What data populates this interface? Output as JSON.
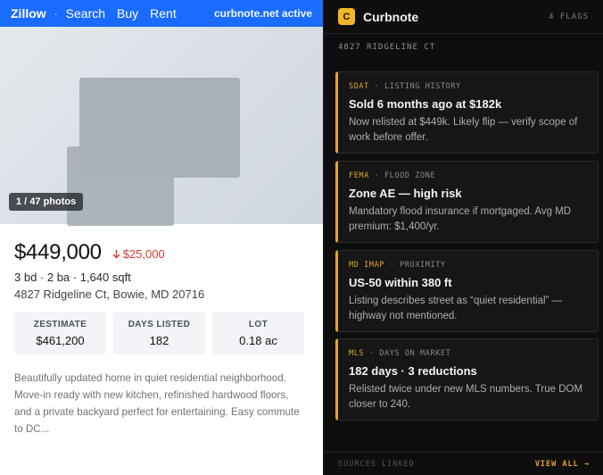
{
  "zillow": {
    "brand": "Zillow",
    "separator": "·",
    "nav": [
      "Search",
      "Buy",
      "Rent"
    ],
    "extension_status": "curbnote.net active",
    "photo_count": "1 / 47 photos",
    "price": "$449,000",
    "price_drop": "$25,000",
    "facts": "3 bd · 2 ba · 1,640 sqft",
    "address": "4827 Ridgeline Ct, Bowie, MD 20716",
    "stats": [
      {
        "label": "ZESTIMATE",
        "value": "$461,200"
      },
      {
        "label": "DAYS LISTED",
        "value": "182"
      },
      {
        "label": "LOT",
        "value": "0.18 ac"
      }
    ],
    "description": "Beautifully updated home in quiet residential neighborhood. Move-in ready with new kitchen, refinished hardwood floors, and a private backyard perfect for entertaining. Easy commute to DC..."
  },
  "panel": {
    "logo_letter": "C",
    "title": "Curbnote",
    "flags": "4 FLAGS",
    "address": "4827 RIDGELINE CT",
    "cards": [
      {
        "source": "SDAT",
        "category": "LISTING HISTORY",
        "title": "Sold 6 months ago at $182k",
        "body": "Now relisted at $449k. Likely flip — verify scope of work before offer."
      },
      {
        "source": "FEMA",
        "category": "FLOOD ZONE",
        "title": "Zone AE — high risk",
        "body": "Mandatory flood insurance if mortgaged. Avg MD premium: $1,400/yr."
      },
      {
        "source": "MD IMAP",
        "category": "PROXIMITY",
        "title": "US-50 within 380 ft",
        "body": "Listing describes street as “quiet residential” — highway not mentioned."
      },
      {
        "source": "MLS",
        "category": "DAYS ON MARKET",
        "title": "182 days · 3 reductions",
        "body": "Relisted twice under new MLS numbers. True DOM closer to 240."
      }
    ],
    "meta_separator": "·",
    "footer_sources": "SOURCES LINKED",
    "footer_view_all": "VIEW ALL →"
  },
  "colors": {
    "zillow_blue": "#1a6bff",
    "accent_amber": "#e2a42c",
    "price_drop_red": "#d63a2f",
    "panel_bg": "#0e0e0e"
  },
  "icons": {
    "price_drop": "arrow-down-icon",
    "logo": "curbnote-logo-icon"
  }
}
